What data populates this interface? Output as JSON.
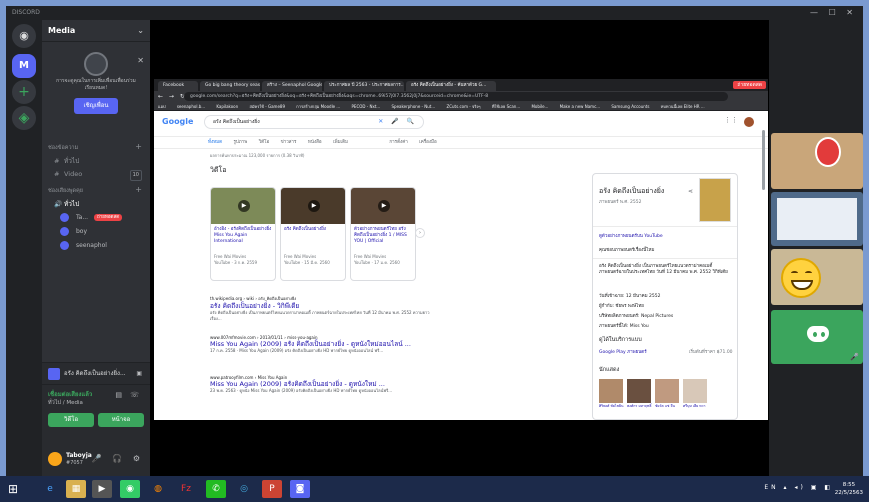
{
  "window": {
    "title": "DISCORD",
    "controls": "— ☐ ✕"
  },
  "server": {
    "name": "Media",
    "initial": "M"
  },
  "invite": {
    "text": "การจะดูคุณในการเพิ่มเพื่อนเพื่อนร่วมเรียนหมด!",
    "button": "เชิญเพื่อน"
  },
  "categories": {
    "text": "ช่องข้อความ",
    "voice": "ช่องเสียงพูดคุย"
  },
  "channels": {
    "text": [
      {
        "name": "ทั่วไป",
        "count": ""
      },
      {
        "name": "Video",
        "count": "10"
      }
    ],
    "voice": [
      {
        "name": "ทั่วไป"
      }
    ]
  },
  "members": [
    {
      "name": "Ta...",
      "live": "ถ่ายทอดสด"
    },
    {
      "name": "boy",
      "live": ""
    },
    {
      "name": "seenaphol",
      "live": ""
    }
  ],
  "activity": {
    "text": "อรัง คิดถึงเป็นอย่างยิ่ง..."
  },
  "voice_status": {
    "line1": "เชื่อมต่อเสียงแล้ว",
    "line2": "ทั่วไป / Media",
    "video_button": "วิดีโอ",
    "screen_button": "หน้าจอ"
  },
  "user": {
    "name": "Taboyja",
    "tag": "#7057"
  },
  "live_badge": "ถ่ายทอดสด",
  "browser": {
    "tabs": [
      "Facebook",
      "Go big bang theory season 1/...",
      "สร้าง – Seenaphol Google",
      "ประกาศผล ปี 2563 - ประกาศผลการ...",
      "อรัง คิดถึงเป็นอย่างยิ่ง - ค้นหาด้วย G..."
    ],
    "url": "google.com/search?q=อรัง+คิดถึงเป็นอย่างยิ่ง&oq=อรัง+คิดถึงเป็นอย่างยิ่ง&aqs=chrome..69i57j0l7.3562j0j7&sourceid=chrome&ie=UTF-8",
    "bookmarks": [
      "แอป",
      "seenaphol.b...",
      "Kapilakoon",
      "สมัครใช้ - Game89",
      "การสร้างกลุ่ม Moodle ...",
      "PECOD - Nxt...",
      "Speakerphone - Nut...",
      "ZCuts.com - จริงๆ",
      "ที่ใช้เลย Scan...",
      "Mobile...",
      "Make a new Namc...",
      "Samsung Accounts",
      "ทบทวนนี้เลย Elite HR ..."
    ]
  },
  "google": {
    "logo": "Google",
    "query": "อรัง คิดถึงเป็นอย่างยิ่ง",
    "tabs": [
      "ทั้งหมด",
      "รูปภาพ",
      "วิดีโอ",
      "ข่าวสาร",
      "หนังสือ",
      "เพิ่มเติม",
      "การตั้งค่า",
      "เครื่องมือ"
    ],
    "stats": "ผลการค้นหาประมาณ 123,000 รายการ (0.38 วินาที)",
    "videos_heading": "วิดีโอ",
    "videos": [
      {
        "duration": "2:55",
        "title": "อ้างอิง - อรังคิดถึงเป็นอย่างยิ่ง Miss You Again International",
        "source": "Free Wai Movies",
        "platform": "YouTube · 3 ก.ค. 2559"
      },
      {
        "duration": "2:09",
        "title": "อรัง คิดถึงเป็นอย่างยิ่ง",
        "source": "Free Wai Movies",
        "platform": "YouTube · 15 มี.ค. 2560"
      },
      {
        "duration": "4:39",
        "title": "ตัวอย่างภาพยนตร์ไทย อรัง คิดถึงเป็นอย่างยิ่ง 1 / MISS YOU | Official",
        "source": "Free Wai Movies",
        "platform": "YouTube · 17 ม.ค. 2560"
      }
    ],
    "results": [
      {
        "cite": "th.wikipedia.org › wiki › อรัง_คิดถึงเป็นอย่างยิ่ง",
        "title": "อรัง คิดถึงเป็นอย่างยิ่ง - วิกิพีเดีย",
        "snippet": "อรัง คิดถึงเป็นอย่างยิ่ง เป็นภาพยนตร์ไทยแนวดราม่าคอเมดี้ ภาพยนตร์ฉายในประเทศไทย วันที่ 12 มีนาคม พ.ศ. 2552 ความยาวเรื่อง..."
      },
      {
        "cite": "www.007mfmovie.com › 2013/01/11 › miss-you-again",
        "title": "Miss You Again (2009) อรัง คิดถึงเป็นอย่างยิ่ง - ดูหนังใหม่ออนไลน์ ...",
        "snippet": "17 ก.ค. 2558 · Miss You Again (2009) อรัง คิดถึงเป็นอย่างยิ่ง HD พากย์ไทย ดูหนังออนไลน์ ฟรี..."
      },
      {
        "cite": "www.patrooyfilm.com › Miss You Again",
        "title": "Miss You Again (2009) อรังคิดถึงเป็นอย่างยิ่ง - ดูหนังใหม่ ...",
        "snippet": "23 พ.ค. 2563 · ดูหนัง Miss You Again (2009) อรังคิดถึงเป็นอย่างยิ่ง HD พากย์ไทย ดูหนังออนไลน์ฟรี..."
      }
    ],
    "knowledge_panel": {
      "title": "อรัง คิดถึงเป็นอย่างยิ่ง",
      "subtitle": "ภาพยนตร์ พ.ศ. 2552",
      "trailer": "ดูตัวอย่างภาพยนตร์บน YouTube",
      "rating_q": "คุณชอบภาพยนตร์เรื่องนี้ไหม",
      "desc": "อรัง คิดถึงเป็นอย่างยิ่ง เป็นภาพยนตร์ไทยแนวดราม่าคอเมดี้ ภาพยนตร์ฉายในประเทศไทย วันที่ 12 มีนาคม พ.ศ. 2552 วิกิพีเดีย",
      "release": "วันที่เข้าฉาย: 12 มีนาคม 2552",
      "director": "ผู้กำกับ: ชัยพร พงษ์ไทย",
      "company": "บริษัทผลิตภาพยนตร์: Nepal Pictures",
      "music": "ภาพยนตร์นี้ได้: Miss You",
      "watch_heading": "ดูได้ในบริการแบบ",
      "provider": "Google Play ภาพยนตร์",
      "price": "เริ่มต้นที่ราคา ฿71.00",
      "cast_heading": "นักแสดง",
      "cast": [
        "ศิริพงศ์ ชัยไชยิน",
        "พงศ์กร มหาฤทธิ์",
        "ชัยวัต แซ่ จีน",
        "ศรีบุษ เฮีย หวา"
      ]
    },
    "icons": {
      "clear": "clear-icon",
      "mic": "mic-icon",
      "search": "search-icon"
    }
  },
  "taskbar": {
    "apps": [
      "e",
      "▦",
      "▶",
      "◉",
      "◍",
      "Fz",
      "✆",
      "◎",
      "P",
      "◙"
    ],
    "tray": "EN ▴ ◂) ▣ ◧",
    "time": "8:55",
    "date": "22/5/2563"
  },
  "colors": {
    "brand": "#5865f2",
    "green": "#3ba55d",
    "live": "#ed4245"
  }
}
